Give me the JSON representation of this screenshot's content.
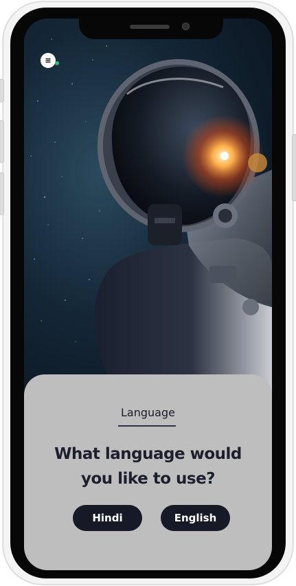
{
  "app": {
    "menu_icon": "menu-icon",
    "hero_image": "astronaut-in-space"
  },
  "language_screen": {
    "section_label": "Language",
    "question": "What language would you like to use?",
    "options": [
      {
        "label": "Hindi"
      },
      {
        "label": "English"
      }
    ]
  },
  "colors": {
    "sheet_background": "#bfbebe",
    "button_background": "#161a26",
    "button_text": "#ffffff",
    "heading_text": "#1d1f2e"
  }
}
